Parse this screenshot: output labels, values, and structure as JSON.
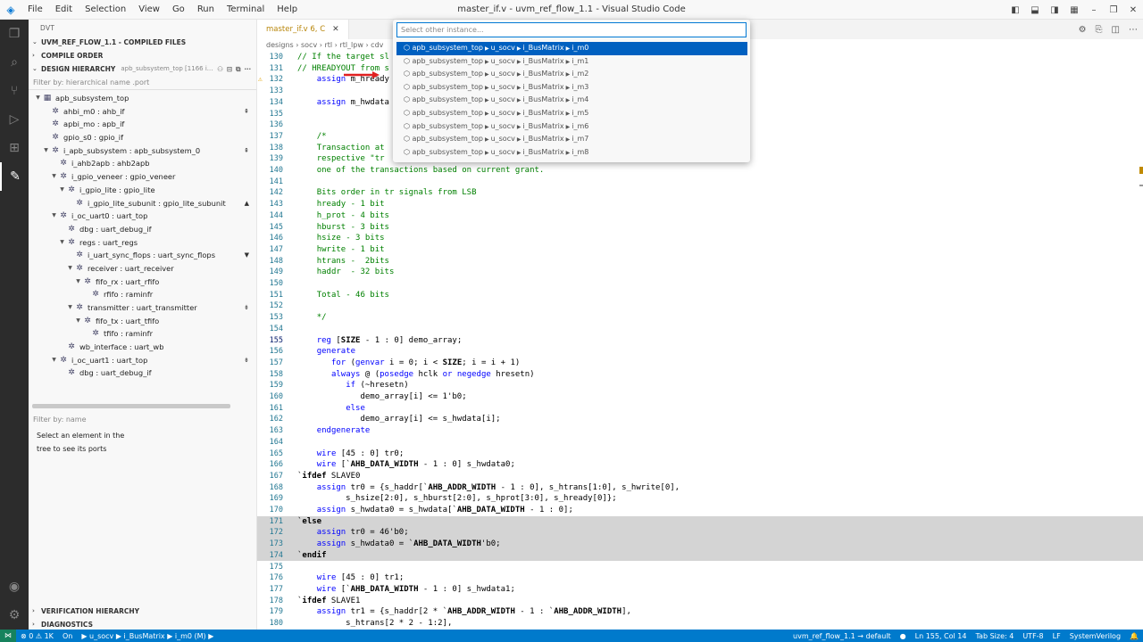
{
  "titlebar": {
    "menu": [
      "File",
      "Edit",
      "Selection",
      "View",
      "Go",
      "Run",
      "Terminal",
      "Help"
    ],
    "title": "master_if.v - uvm_ref_flow_1.1 - Visual Studio Code"
  },
  "sidebar": {
    "header": "DVT",
    "project": "UVM_REF_FLOW_1.1 - COMPILED FILES",
    "compile_order": "COMPILE ORDER",
    "design_hierarchy": "DESIGN HIERARCHY",
    "design_hierarchy_extra": "apb_subsystem_top [1166 i...",
    "filter_placeholder": "Filter by: hierarchical name .port",
    "tree": [
      {
        "label": "apb_subsystem_top",
        "indent": 0,
        "twisty": "v",
        "pin": ""
      },
      {
        "label": "ahbi_m0 : ahb_if",
        "indent": 1,
        "twisty": "",
        "pin": "⇞"
      },
      {
        "label": "apbi_mo : apb_if",
        "indent": 1,
        "twisty": "",
        "pin": ""
      },
      {
        "label": "gpio_s0 : gpio_if",
        "indent": 1,
        "twisty": "",
        "pin": ""
      },
      {
        "label": "i_apb_subsystem : apb_subsystem_0",
        "indent": 1,
        "twisty": "v",
        "pin": "⇞"
      },
      {
        "label": "i_ahb2apb : ahb2apb",
        "indent": 2,
        "twisty": "",
        "pin": ""
      },
      {
        "label": "i_gpio_veneer : gpio_veneer",
        "indent": 2,
        "twisty": "v",
        "pin": ""
      },
      {
        "label": "i_gpio_lite : gpio_lite",
        "indent": 3,
        "twisty": "v",
        "pin": ""
      },
      {
        "label": "i_gpio_lite_subunit : gpio_lite_subunit",
        "indent": 4,
        "twisty": "",
        "pin": "▲"
      },
      {
        "label": "i_oc_uart0 : uart_top",
        "indent": 2,
        "twisty": "v",
        "pin": ""
      },
      {
        "label": "dbg : uart_debug_if",
        "indent": 3,
        "twisty": "",
        "pin": ""
      },
      {
        "label": "regs : uart_regs",
        "indent": 3,
        "twisty": "v",
        "pin": ""
      },
      {
        "label": "i_uart_sync_flops : uart_sync_flops",
        "indent": 4,
        "twisty": "",
        "pin": "▼"
      },
      {
        "label": "receiver : uart_receiver",
        "indent": 4,
        "twisty": "v",
        "pin": ""
      },
      {
        "label": "fifo_rx : uart_rfifo",
        "indent": 5,
        "twisty": "v",
        "pin": ""
      },
      {
        "label": "rfifo : raminfr",
        "indent": 6,
        "twisty": "",
        "pin": ""
      },
      {
        "label": "transmitter : uart_transmitter",
        "indent": 4,
        "twisty": "v",
        "pin": "⇟"
      },
      {
        "label": "fifo_tx : uart_tfifo",
        "indent": 5,
        "twisty": "v",
        "pin": ""
      },
      {
        "label": "tfifo : raminfr",
        "indent": 6,
        "twisty": "",
        "pin": ""
      },
      {
        "label": "wb_interface : uart_wb",
        "indent": 3,
        "twisty": "",
        "pin": ""
      },
      {
        "label": "i_oc_uart1 : uart_top",
        "indent": 2,
        "twisty": "v",
        "pin": "⇟"
      },
      {
        "label": "dbg : uart_debug_if",
        "indent": 3,
        "twisty": "",
        "pin": ""
      }
    ],
    "ports_filter": "Filter by: name",
    "ports_msg_1": "Select an element in the",
    "ports_msg_2": "tree to see its ports",
    "verification_hierarchy": "VERIFICATION HIERARCHY",
    "diagnostics": "DIAGNOSTICS"
  },
  "editor": {
    "tab_label": "master_if.v 6, C",
    "breadcrumbs": "designs › socv › rtl › rtl_lpw › cdv",
    "palette_placeholder": "Select other instance...",
    "palette_items": [
      [
        "apb_subsystem_top",
        "u_socv",
        "i_BusMatrix",
        "i_m0"
      ],
      [
        "apb_subsystem_top",
        "u_socv",
        "i_BusMatrix",
        "i_m1"
      ],
      [
        "apb_subsystem_top",
        "u_socv",
        "i_BusMatrix",
        "i_m2"
      ],
      [
        "apb_subsystem_top",
        "u_socv",
        "i_BusMatrix",
        "i_m3"
      ],
      [
        "apb_subsystem_top",
        "u_socv",
        "i_BusMatrix",
        "i_m4"
      ],
      [
        "apb_subsystem_top",
        "u_socv",
        "i_BusMatrix",
        "i_m5"
      ],
      [
        "apb_subsystem_top",
        "u_socv",
        "i_BusMatrix",
        "i_m6"
      ],
      [
        "apb_subsystem_top",
        "u_socv",
        "i_BusMatrix",
        "i_m7"
      ],
      [
        "apb_subsystem_top",
        "u_socv",
        "i_BusMatrix",
        "i_m8"
      ]
    ],
    "lines": [
      {
        "n": "130",
        "h": "<span class='cm'>// If the target sl</span>"
      },
      {
        "n": "131",
        "h": "<span class='cm'>// HREADYOUT from s</span>"
      },
      {
        "n": "132",
        "h": "    <span class='kw'>assign</span> m_hready",
        "warn": true
      },
      {
        "n": "133",
        "h": ""
      },
      {
        "n": "134",
        "h": "    <span class='kw'>assign</span> m_hwdata"
      },
      {
        "n": "135",
        "h": ""
      },
      {
        "n": "136",
        "h": ""
      },
      {
        "n": "137",
        "h": "    <span class='cm'>/*</span>"
      },
      {
        "n": "138",
        "h": "    <span class='cm'>Transaction at</span>"
      },
      {
        "n": "139",
        "h": "    <span class='cm'>respective \"tr</span>"
      },
      {
        "n": "140",
        "h": "    <span class='cm'>one of the transactions based on current grant.</span>"
      },
      {
        "n": "141",
        "h": ""
      },
      {
        "n": "142",
        "h": "    <span class='cm'>Bits order in tr signals from LSB</span>"
      },
      {
        "n": "143",
        "h": "    <span class='cm'>hready - 1 bit</span>"
      },
      {
        "n": "144",
        "h": "    <span class='cm'>h_prot - 4 bits</span>"
      },
      {
        "n": "145",
        "h": "    <span class='cm'>hburst - 3 bits</span>"
      },
      {
        "n": "146",
        "h": "    <span class='cm'>hsize - 3 bits</span>"
      },
      {
        "n": "147",
        "h": "    <span class='cm'>hwrite - 1 bit</span>"
      },
      {
        "n": "148",
        "h": "    <span class='cm'>htrans -  2bits</span>"
      },
      {
        "n": "149",
        "h": "    <span class='cm'>haddr  - 32 bits</span>"
      },
      {
        "n": "150",
        "h": ""
      },
      {
        "n": "151",
        "h": "    <span class='cm'>Total - 46 bits</span>"
      },
      {
        "n": "152",
        "h": ""
      },
      {
        "n": "153",
        "h": "    <span class='cm'>*/</span>"
      },
      {
        "n": "154",
        "h": ""
      },
      {
        "n": "155",
        "h": "    <span class='kw'>reg</span> [<span class='macro'>SIZE</span> - 1 : 0] demo_array;",
        "cur": true
      },
      {
        "n": "156",
        "h": "    <span class='kw'>generate</span>"
      },
      {
        "n": "157",
        "h": "       <span class='kw'>for</span> (<span class='kw'>genvar</span> i = 0; i &lt; <span class='macro'>SIZE</span>; i = i + 1)"
      },
      {
        "n": "158",
        "h": "       <span class='kw'>always</span> @ (<span class='kw'>posedge</span> hclk <span class='kw'>or</span> <span class='kw'>negedge</span> hresetn)"
      },
      {
        "n": "159",
        "h": "          <span class='kw'>if</span> (~hresetn)"
      },
      {
        "n": "160",
        "h": "             demo_array[i] &lt;= 1'b0;"
      },
      {
        "n": "161",
        "h": "          <span class='kw'>else</span>"
      },
      {
        "n": "162",
        "h": "             demo_array[i] &lt;= s_hwdata[i];"
      },
      {
        "n": "163",
        "h": "    <span class='kw'>endgenerate</span>"
      },
      {
        "n": "164",
        "h": ""
      },
      {
        "n": "165",
        "h": "    <span class='kw'>wire</span> [45 : 0] tr0;"
      },
      {
        "n": "166",
        "h": "    <span class='kw'>wire</span> [`<span class='macro'>AHB_DATA_WIDTH</span> - 1 : 0] s_hwdata0;"
      },
      {
        "n": "167",
        "h": "`<span class='macro'>ifdef</span> SLAVE0"
      },
      {
        "n": "168",
        "h": "    <span class='kw'>assign</span> tr0 = {s_haddr[`<span class='macro'>AHB_ADDR_WIDTH</span> - 1 : 0], s_htrans[1:0], s_hwrite[0],"
      },
      {
        "n": "169",
        "h": "          s_hsize[2:0], s_hburst[2:0], s_hprot[3:0], s_hready[0]};"
      },
      {
        "n": "170",
        "h": "    <span class='kw'>assign</span> s_hwdata0 = s_hwdata[`<span class='macro'>AHB_DATA_WIDTH</span> - 1 : 0];"
      },
      {
        "n": "171",
        "h": "`<span class='macro'>else</span>",
        "hl": true
      },
      {
        "n": "172",
        "h": "    <span class='kw'>assign</span> tr0 = 46'b0;",
        "hl": true
      },
      {
        "n": "173",
        "h": "    <span class='kw'>assign</span> s_hwdata0 = `<span class='macro'>AHB_DATA_WIDTH</span>'b0;",
        "hl": true
      },
      {
        "n": "174",
        "h": "`<span class='macro'>endif</span>",
        "hl": true
      },
      {
        "n": "175",
        "h": ""
      },
      {
        "n": "176",
        "h": "    <span class='kw'>wire</span> [45 : 0] tr1;"
      },
      {
        "n": "177",
        "h": "    <span class='kw'>wire</span> [`<span class='macro'>AHB_DATA_WIDTH</span> - 1 : 0] s_hwdata1;"
      },
      {
        "n": "178",
        "h": "`<span class='macro'>ifdef</span> SLAVE1"
      },
      {
        "n": "179",
        "h": "    <span class='kw'>assign</span> tr1 = {s_haddr[2 * `<span class='macro'>AHB_ADDR_WIDTH</span> - 1 : `<span class='macro'>AHB_ADDR_WIDTH</span>],"
      },
      {
        "n": "180",
        "h": "          s_htrans[2 * 2 - 1:2],"
      }
    ]
  },
  "statusbar": {
    "remote": "⋈",
    "problems": "⊗ 0 ⚠ 1K",
    "on": "On",
    "crumb": "▶ u_socv ▶ i_BusMatrix ▶ i_m0 (M) ▶",
    "project": "uvm_ref_flow_1.1 → default",
    "position": "Ln 155, Col 14",
    "tabsize": "Tab Size: 4",
    "encoding": "UTF-8",
    "eol": "LF",
    "language": "SystemVerilog"
  }
}
